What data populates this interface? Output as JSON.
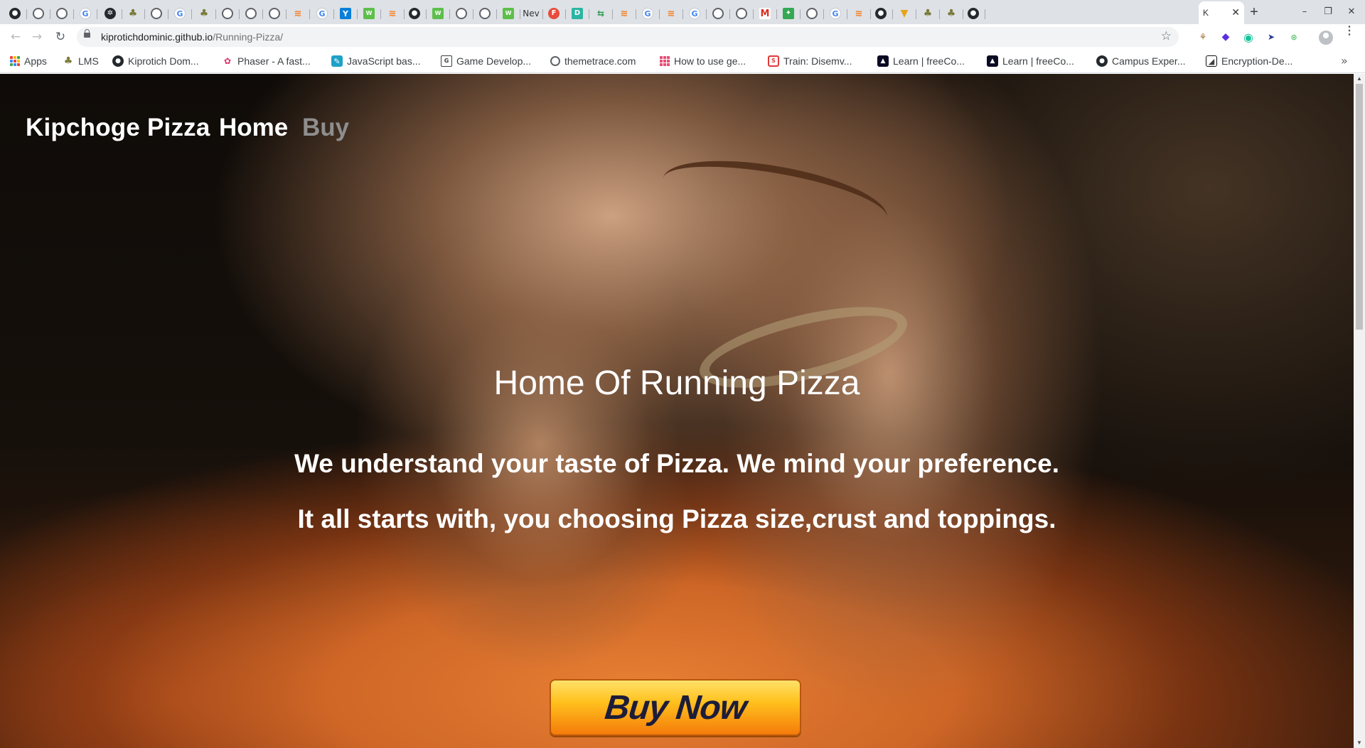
{
  "browser": {
    "active_tab": {
      "title": "K",
      "close": "✕"
    },
    "new_tab": "+",
    "window_controls": {
      "minimize": "–",
      "restore": "❐",
      "close": "✕"
    },
    "tab_favicons": [
      {
        "icon": "github-icon",
        "glyph": "●"
      },
      {
        "icon": "globe-icon",
        "glyph": ""
      },
      {
        "icon": "globe-icon",
        "glyph": ""
      },
      {
        "icon": "google-icon",
        "glyph": "G"
      },
      {
        "icon": "tool-icon",
        "glyph": "✲"
      },
      {
        "icon": "palm-icon",
        "glyph": "♣"
      },
      {
        "icon": "globe-icon",
        "glyph": ""
      },
      {
        "icon": "google-icon",
        "glyph": "G"
      },
      {
        "icon": "palm-icon",
        "glyph": "♣"
      },
      {
        "icon": "globe-icon",
        "glyph": ""
      },
      {
        "icon": "globe-icon",
        "glyph": ""
      },
      {
        "icon": "globe-icon",
        "glyph": ""
      },
      {
        "icon": "stackoverflow-icon",
        "glyph": "≋"
      },
      {
        "icon": "google-icon",
        "glyph": "G"
      },
      {
        "icon": "twitter-tab-icon",
        "glyph": "Y"
      },
      {
        "icon": "whatsapp-icon",
        "glyph": "W"
      },
      {
        "icon": "stackoverflow-icon",
        "glyph": "≋"
      },
      {
        "icon": "github-icon",
        "glyph": "●"
      },
      {
        "icon": "whatsapp-icon",
        "glyph": "W"
      },
      {
        "icon": "globe-icon",
        "glyph": ""
      },
      {
        "icon": "globe-icon",
        "glyph": ""
      },
      {
        "icon": "whatsapp-icon",
        "glyph": "W"
      },
      {
        "icon": "text-tab-icon",
        "glyph": "Nev"
      },
      {
        "icon": "red-f-icon",
        "glyph": "F"
      },
      {
        "icon": "teal-d-icon",
        "glyph": "D"
      },
      {
        "icon": "green-dev-icon",
        "glyph": "⇆"
      },
      {
        "icon": "stackoverflow-icon",
        "glyph": "≋"
      },
      {
        "icon": "google-icon",
        "glyph": "G"
      },
      {
        "icon": "stackoverflow-icon",
        "glyph": "≋"
      },
      {
        "icon": "google-icon",
        "glyph": "G"
      },
      {
        "icon": "globe-icon",
        "glyph": ""
      },
      {
        "icon": "globe-icon",
        "glyph": ""
      },
      {
        "icon": "gmail-icon",
        "glyph": "M"
      },
      {
        "icon": "maps-icon",
        "glyph": "✦"
      },
      {
        "icon": "globe-icon",
        "glyph": ""
      },
      {
        "icon": "google-icon",
        "glyph": "G"
      },
      {
        "icon": "stackoverflow-icon",
        "glyph": "≋"
      },
      {
        "icon": "github-icon",
        "glyph": "●"
      },
      {
        "icon": "pizza-icon",
        "glyph": "▼"
      },
      {
        "icon": "palm-icon",
        "glyph": "♣"
      },
      {
        "icon": "palm-icon",
        "glyph": "♣"
      },
      {
        "icon": "github-icon",
        "glyph": "●"
      }
    ],
    "nav": {
      "back": "←",
      "forward": "→",
      "reload": "↻"
    },
    "address": {
      "domain": "kiprotichdominic.github.io",
      "path": "/Running-Pizza/"
    },
    "bookmark_star": "☆",
    "extensions": [
      {
        "icon": "extension-icon",
        "glyph": "⚘"
      },
      {
        "icon": "extension-icon",
        "glyph": "◆"
      },
      {
        "icon": "grammarly-icon",
        "glyph": "◉"
      },
      {
        "icon": "extension-icon",
        "glyph": "➤"
      },
      {
        "icon": "extension-icon",
        "glyph": "⊛"
      }
    ],
    "menu": "⋮",
    "bookmarks": [
      {
        "label": "Apps",
        "icon": "apps-icon"
      },
      {
        "label": "LMS",
        "icon": "palm-icon"
      },
      {
        "label": "Kiprotich Dom...",
        "icon": "github-icon"
      },
      {
        "label": "Phaser - A fast...",
        "icon": "phaser-icon"
      },
      {
        "label": "JavaScript bas...",
        "icon": "javascript-icon"
      },
      {
        "label": "Game Develop...",
        "icon": "document-icon"
      },
      {
        "label": "themetrace.com",
        "icon": "globe-icon"
      },
      {
        "label": "How to use ge...",
        "icon": "grid-icon"
      },
      {
        "label": "Train: Disemv...",
        "icon": "train-icon"
      },
      {
        "label": "Learn | freeCo...",
        "icon": "freecodecamp-icon"
      },
      {
        "label": "Learn | freeCo...",
        "icon": "freecodecamp-icon"
      },
      {
        "label": "Campus Exper...",
        "icon": "github-icon"
      },
      {
        "label": "Encryption-De...",
        "icon": "encryption-icon"
      }
    ],
    "bookmarks_more": "»"
  },
  "page": {
    "brand": "Kipchoge Pizza",
    "nav": {
      "home": "Home",
      "buy": "Buy"
    },
    "hero": {
      "title": "Home Of Running Pizza",
      "line1": "We understand your taste of Pizza. We mind your preference.",
      "line2": "It all starts with, you choosing Pizza size,crust and toppings."
    },
    "cta": "Buy Now"
  },
  "colors": {
    "nav_inactive": "#8e8e8e",
    "cta_gradient_top": "#ffe16a",
    "cta_gradient_bottom": "#f47b0b",
    "cta_text": "#1d1d3a"
  }
}
